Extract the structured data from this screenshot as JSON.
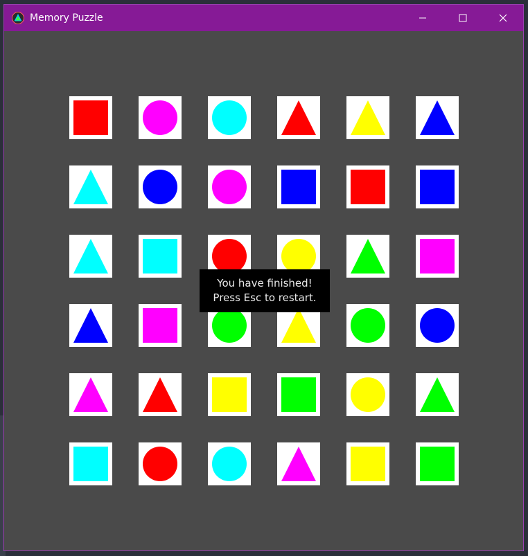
{
  "window": {
    "title": "Memory Puzzle"
  },
  "icons": {
    "app": "triangle-app-icon",
    "minimize": "minimize-icon",
    "maximize": "maximize-icon",
    "close": "close-icon"
  },
  "colors": {
    "titlebar": "#861a96",
    "background": "#4a4a4a",
    "card": "#ffffff",
    "red": "#ff0000",
    "magenta": "#ff00ff",
    "cyan": "#00ffff",
    "yellow": "#ffff00",
    "blue": "#0000ff",
    "green": "#00ff00"
  },
  "board": {
    "rows": [
      [
        {
          "shape": "square",
          "color": "red"
        },
        {
          "shape": "circle",
          "color": "magenta"
        },
        {
          "shape": "circle",
          "color": "cyan"
        },
        {
          "shape": "triangle",
          "color": "red"
        },
        {
          "shape": "triangle",
          "color": "yellow"
        },
        {
          "shape": "triangle",
          "color": "blue"
        }
      ],
      [
        {
          "shape": "triangle",
          "color": "cyan"
        },
        {
          "shape": "circle",
          "color": "blue"
        },
        {
          "shape": "circle",
          "color": "magenta"
        },
        {
          "shape": "square",
          "color": "blue"
        },
        {
          "shape": "square",
          "color": "red"
        },
        {
          "shape": "square",
          "color": "blue"
        }
      ],
      [
        {
          "shape": "triangle",
          "color": "cyan"
        },
        {
          "shape": "square",
          "color": "cyan"
        },
        {
          "shape": "circle",
          "color": "red"
        },
        {
          "shape": "circle",
          "color": "yellow"
        },
        {
          "shape": "triangle",
          "color": "green"
        },
        {
          "shape": "square",
          "color": "magenta"
        }
      ],
      [
        {
          "shape": "triangle",
          "color": "blue"
        },
        {
          "shape": "square",
          "color": "magenta"
        },
        {
          "shape": "circle",
          "color": "green"
        },
        {
          "shape": "triangle",
          "color": "yellow"
        },
        {
          "shape": "circle",
          "color": "green"
        },
        {
          "shape": "circle",
          "color": "blue"
        }
      ],
      [
        {
          "shape": "triangle",
          "color": "magenta"
        },
        {
          "shape": "triangle",
          "color": "red"
        },
        {
          "shape": "square",
          "color": "yellow"
        },
        {
          "shape": "square",
          "color": "green"
        },
        {
          "shape": "circle",
          "color": "yellow"
        },
        {
          "shape": "triangle",
          "color": "green"
        }
      ],
      [
        {
          "shape": "square",
          "color": "cyan"
        },
        {
          "shape": "circle",
          "color": "red"
        },
        {
          "shape": "circle",
          "color": "cyan"
        },
        {
          "shape": "triangle",
          "color": "magenta"
        },
        {
          "shape": "square",
          "color": "yellow"
        },
        {
          "shape": "square",
          "color": "green"
        }
      ]
    ]
  },
  "message": {
    "line1": "You have finished!",
    "line2": "Press Esc to restart."
  }
}
